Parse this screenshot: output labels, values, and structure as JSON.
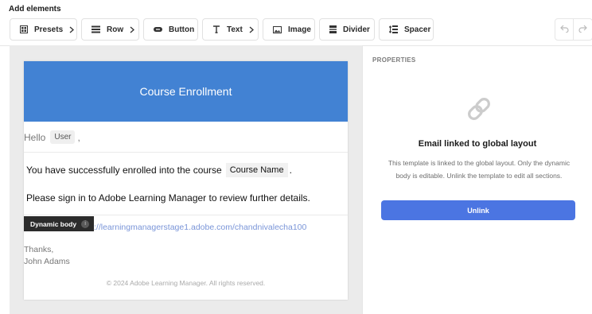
{
  "toolbar": {
    "title": "Add elements",
    "buttons": [
      {
        "label": "Presets",
        "icon": "presets-icon",
        "has_chevron": true
      },
      {
        "label": "Row",
        "icon": "row-icon",
        "has_chevron": true
      },
      {
        "label": "Button",
        "icon": "button-icon",
        "has_chevron": false
      },
      {
        "label": "Text",
        "icon": "text-icon",
        "has_chevron": true
      },
      {
        "label": "Image",
        "icon": "image-icon",
        "has_chevron": false
      },
      {
        "label": "Divider",
        "icon": "divider-icon",
        "has_chevron": false
      },
      {
        "label": "Spacer",
        "icon": "spacer-icon",
        "has_chevron": false
      }
    ],
    "undo_icon": "undo-icon",
    "redo_icon": "redo-icon"
  },
  "email": {
    "header_title": "Course Enrollment",
    "greeting": "Hello",
    "user_placeholder": "User",
    "greeting_suffix": ",",
    "line1_prefix": "You have successfully enrolled into the course",
    "course_placeholder": "Course Name",
    "line1_suffix": ".",
    "line2": "Please sign in to Adobe Learning Manager to review further details.",
    "dynamic_tag": "Dynamic body",
    "link_text": "://learningmanagerstage1.adobe.com/chandnivalecha100",
    "thanks": "Thanks,",
    "signature": "John Adams",
    "footer": "© 2024 Adobe Learning Manager. All rights reserved."
  },
  "properties": {
    "title": "PROPERTIES",
    "linked_title": "Email linked to global layout",
    "linked_desc": "This template is linked to the global layout. Only the dynamic body is editable. Unlink the template to edit all sections.",
    "unlink_label": "Unlink"
  },
  "colors": {
    "header_bg": "#4282d3",
    "unlink_bg": "#4b75e2",
    "link_color": "#7a95d8"
  }
}
